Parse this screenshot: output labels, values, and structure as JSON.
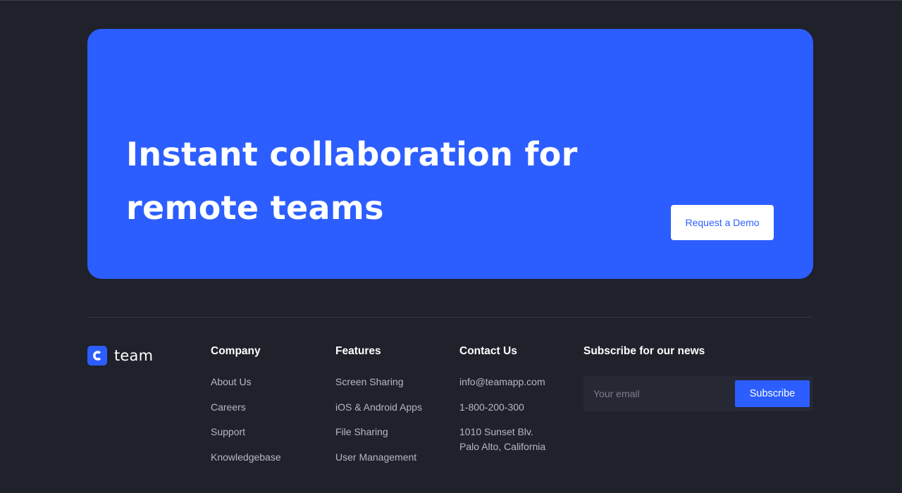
{
  "hero": {
    "title": "Instant collaboration for remote teams",
    "cta_label": "Request a Demo"
  },
  "brand": {
    "logo_letter": "C",
    "name": "team"
  },
  "footer": {
    "company": {
      "heading": "Company",
      "links": [
        "About Us",
        "Careers",
        "Support",
        "Knowledgebase"
      ]
    },
    "features": {
      "heading": "Features",
      "links": [
        "Screen Sharing",
        "iOS & Android Apps",
        "File Sharing",
        "User Management"
      ]
    },
    "contact": {
      "heading": "Contact Us",
      "email": "info@teamapp.com",
      "phone": "1-800-200-300",
      "address_line1": "1010 Sunset Blv.",
      "address_line2": "Palo Alto, California"
    },
    "subscribe": {
      "heading": "Subscribe for our news",
      "placeholder": "Your email",
      "button_label": "Subscribe"
    }
  },
  "colors": {
    "background": "#1f212b",
    "accent": "#2c5eff",
    "muted_text": "#b7b9c2"
  }
}
